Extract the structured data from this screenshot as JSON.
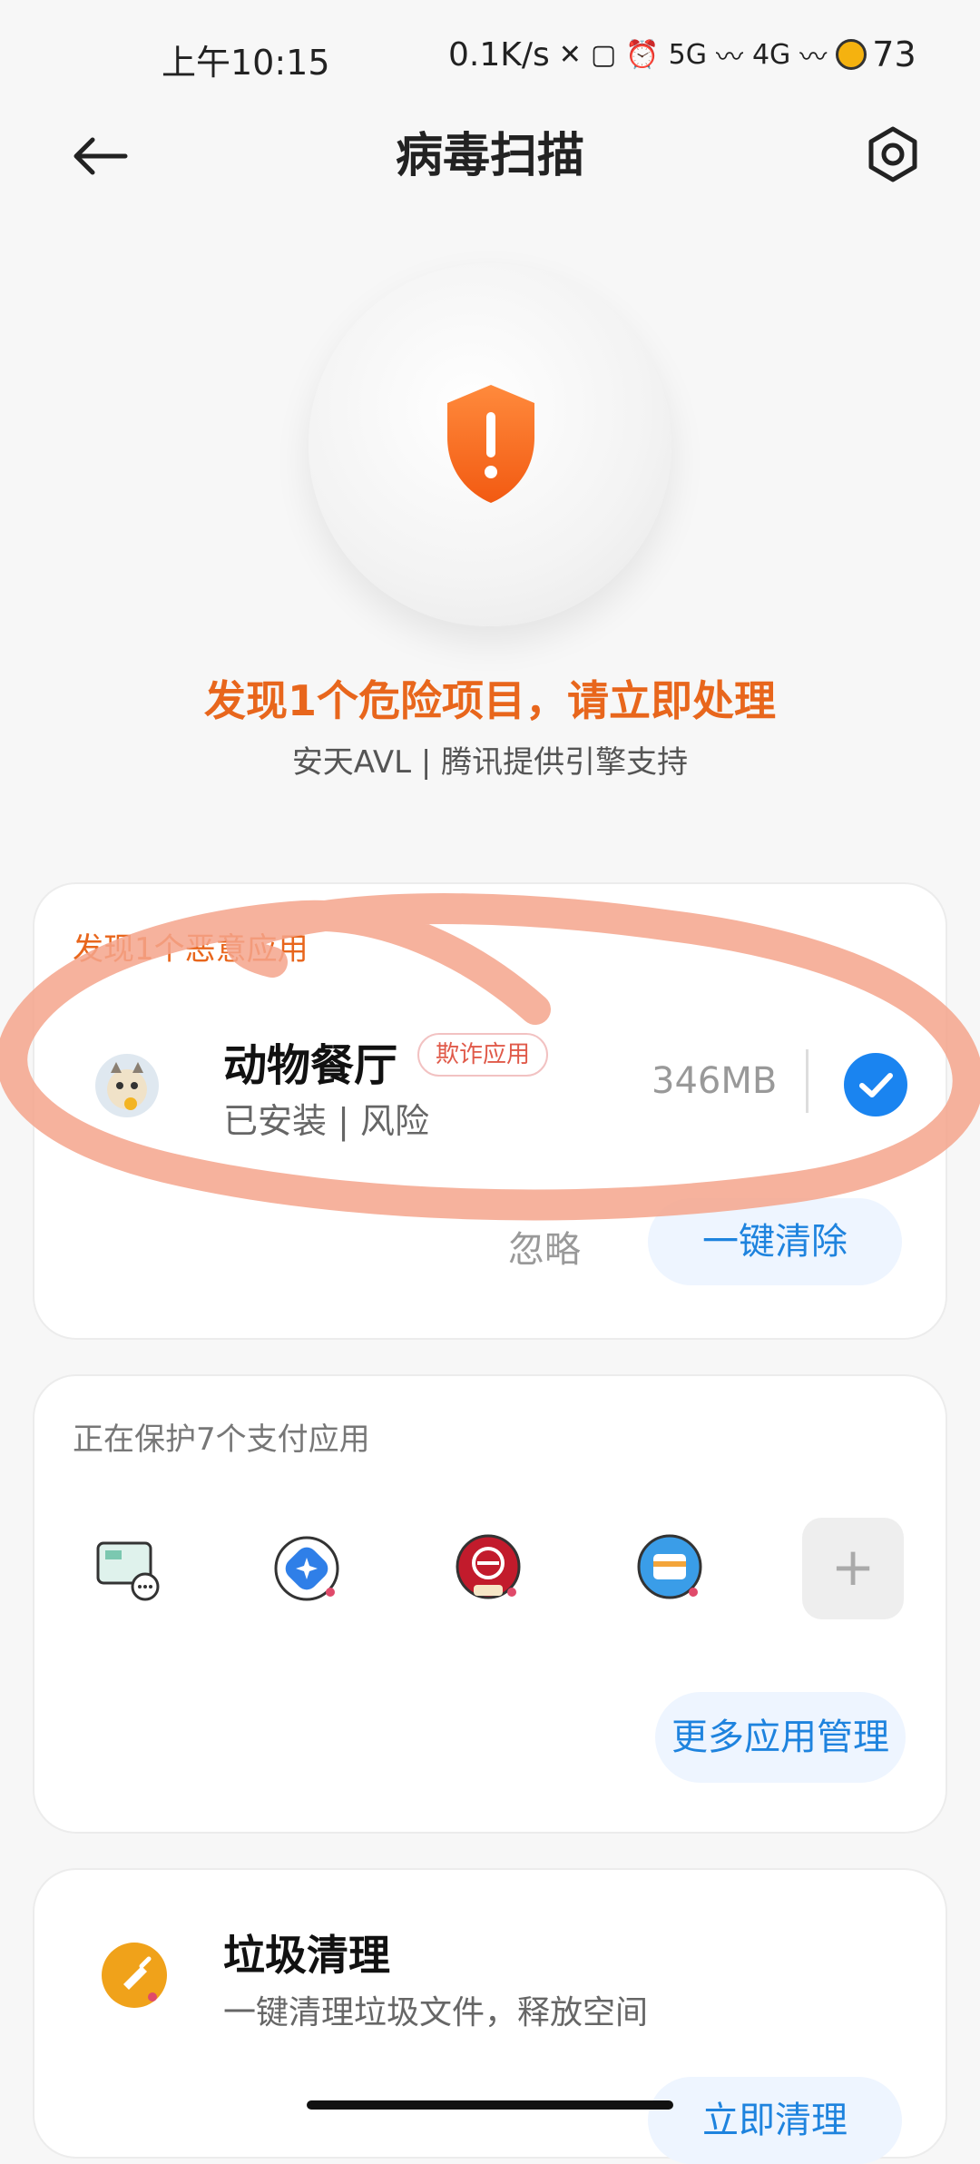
{
  "status_bar": {
    "time": "上午10:15",
    "net_speed": "0.1K/s",
    "sig1": "5G",
    "sig2": "4G",
    "battery": "73"
  },
  "header": {
    "title": "病毒扫描"
  },
  "hero": {
    "title": "发现1个危险项目，请立即处理",
    "subtitle": "安天AVL | 腾讯提供引擎支持"
  },
  "malware_card": {
    "heading": "发现1个恶意应用",
    "app": {
      "name": "动物餐厅",
      "tag": "欺诈应用",
      "status": "已安装 | 风险",
      "size": "346MB",
      "selected": true
    },
    "ignore_label": "忽略",
    "clean_label": "一键清除"
  },
  "payment_card": {
    "heading": "正在保护7个支付应用",
    "icons": [
      "payment-app-1-icon",
      "payment-app-2-icon",
      "payment-app-3-icon",
      "payment-app-4-icon"
    ],
    "add_label": "+",
    "more_label": "更多应用管理"
  },
  "junk_card": {
    "title": "垃圾清理",
    "subtitle": "一键清理垃圾文件，释放空间",
    "button_label": "立即清理"
  },
  "colors": {
    "warning": "#e8661c",
    "primary": "#1a84f0",
    "annotation": "#f4a48c"
  }
}
